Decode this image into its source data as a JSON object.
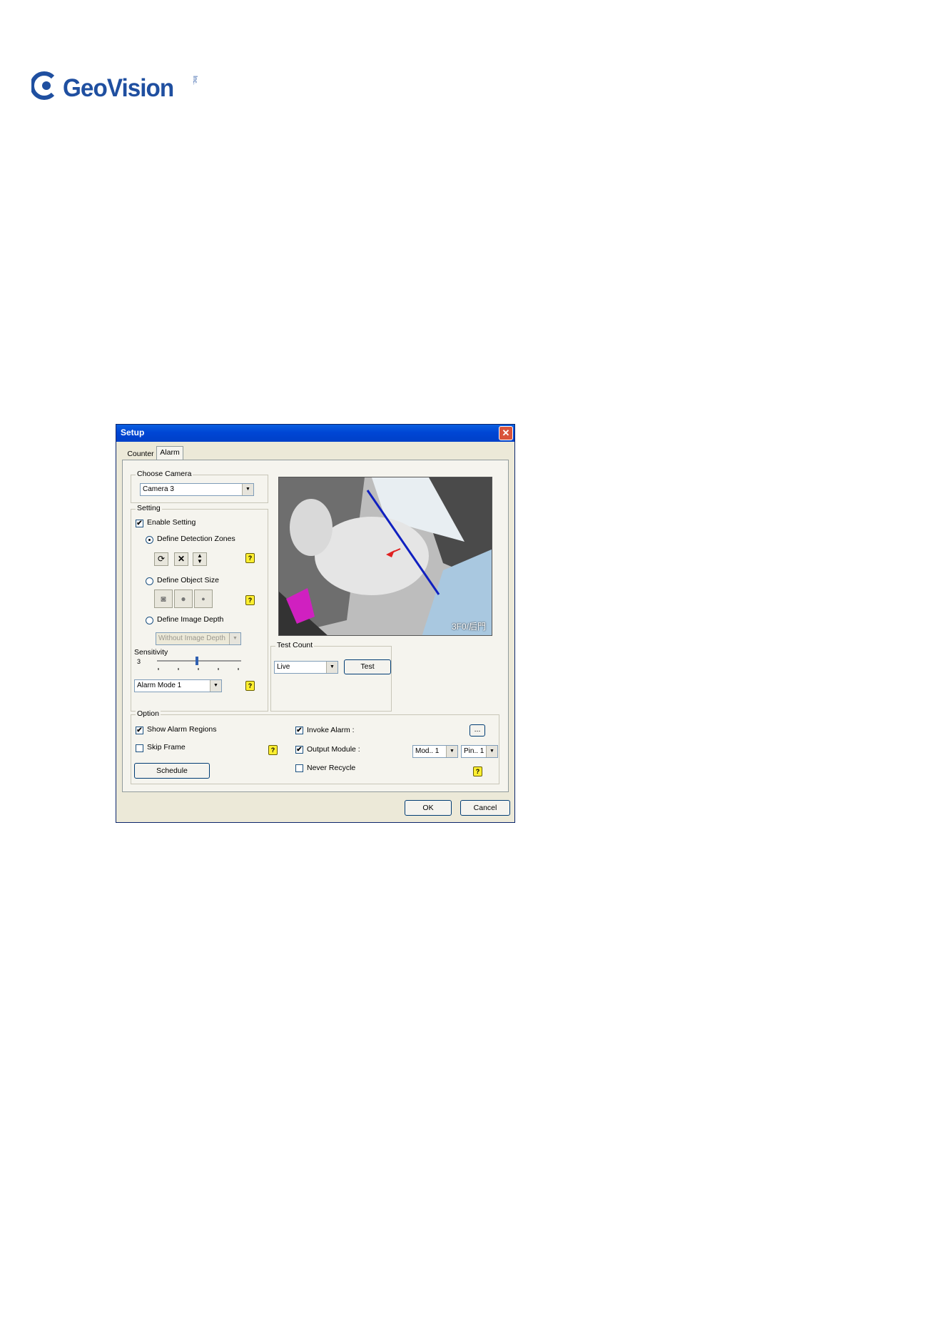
{
  "logo": {
    "brand": "GeoVision",
    "tm": "Inc."
  },
  "dialog": {
    "title": "Setup",
    "tabs": [
      "Counter",
      "Alarm"
    ],
    "choose_camera": {
      "legend": "Choose Camera",
      "value": "Camera 3"
    },
    "setting": {
      "legend": "Setting",
      "enable": "Enable Setting",
      "define_zones": "Define Detection Zones",
      "define_size": "Define Object Size",
      "define_depth": "Define Image Depth",
      "depth_combo": "Without Image Depth",
      "sensitivity": "Sensitivity",
      "sensitivity_value": "3",
      "alarm_mode": "Alarm Mode 1"
    },
    "camera_view": {
      "stamp": "3F0/后門"
    },
    "test_count": {
      "legend": "Test Count",
      "mode": "Live",
      "button": "Test"
    },
    "option": {
      "legend": "Option",
      "show_regions": "Show Alarm Regions",
      "skip_frame": "Skip Frame",
      "schedule": "Schedule",
      "invoke_alarm": "Invoke Alarm :",
      "invoke_btn": "...",
      "output_module": "Output Module :",
      "module": "Mod.. 1",
      "pin": "Pin.. 1",
      "never_recycle": "Never Recycle"
    },
    "ok": "OK",
    "cancel": "Cancel",
    "help_glyph": "?",
    "check_glyph": "✔"
  }
}
